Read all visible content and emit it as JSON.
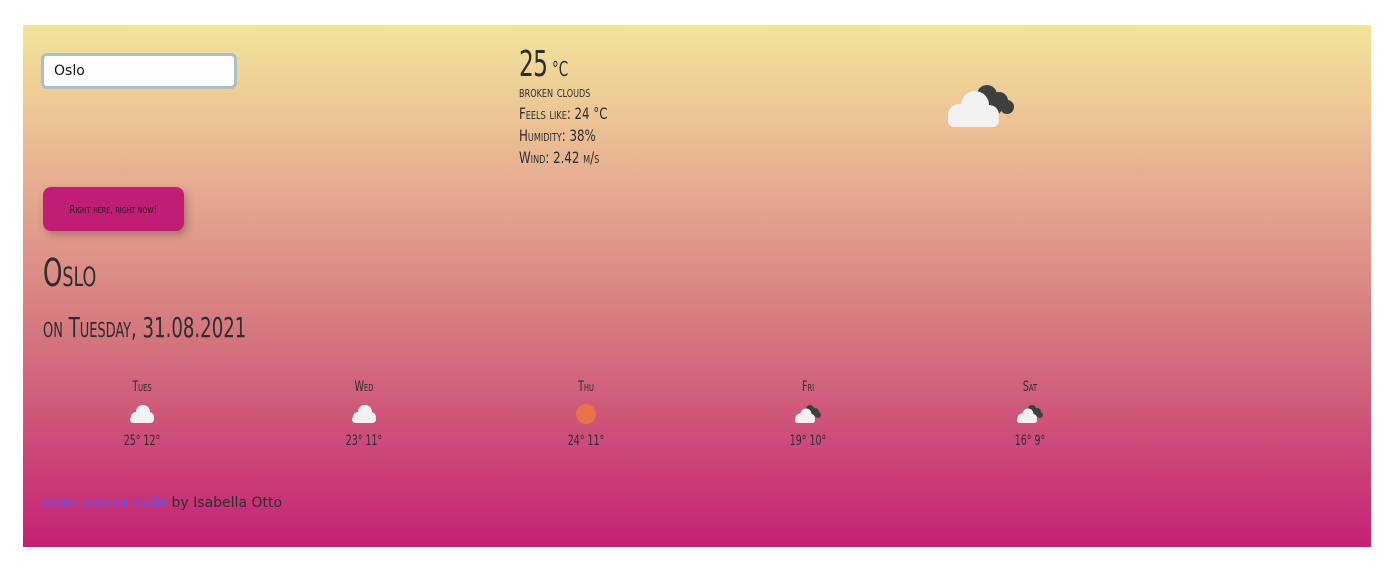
{
  "search": {
    "value": "Oslo"
  },
  "current": {
    "temperature": "25",
    "unit": "°C",
    "description": "broken clouds",
    "feels_like": "Feels like: 24 °C",
    "humidity": "Humidity: 38%",
    "wind": "Wind: 2.42 m/s",
    "icon": "broken-clouds-icon"
  },
  "location_button": {
    "label": "Right here, right now!"
  },
  "city": "Oslo",
  "date": "on Tuesday, 31.08.2021",
  "forecast": [
    {
      "day": "Tues",
      "icon": "cloud-icon",
      "temps": "25° 12°"
    },
    {
      "day": "Wed",
      "icon": "cloud-icon",
      "temps": "23° 11°"
    },
    {
      "day": "Thu",
      "icon": "sun-icon",
      "temps": "24° 11°"
    },
    {
      "day": "Fri",
      "icon": "broken-clouds-icon",
      "temps": "19° 10°"
    },
    {
      "day": "Sat",
      "icon": "broken-clouds-icon",
      "temps": "16° 9°"
    }
  ],
  "footer": {
    "link_label": "open source code",
    "credit": " by Isabella Otto"
  },
  "colors": {
    "gradient_top": "#f3e59a",
    "gradient_bottom": "#c52174",
    "button": "#c21d75",
    "sun": "#e8734a",
    "link": "#6a4ff0"
  }
}
